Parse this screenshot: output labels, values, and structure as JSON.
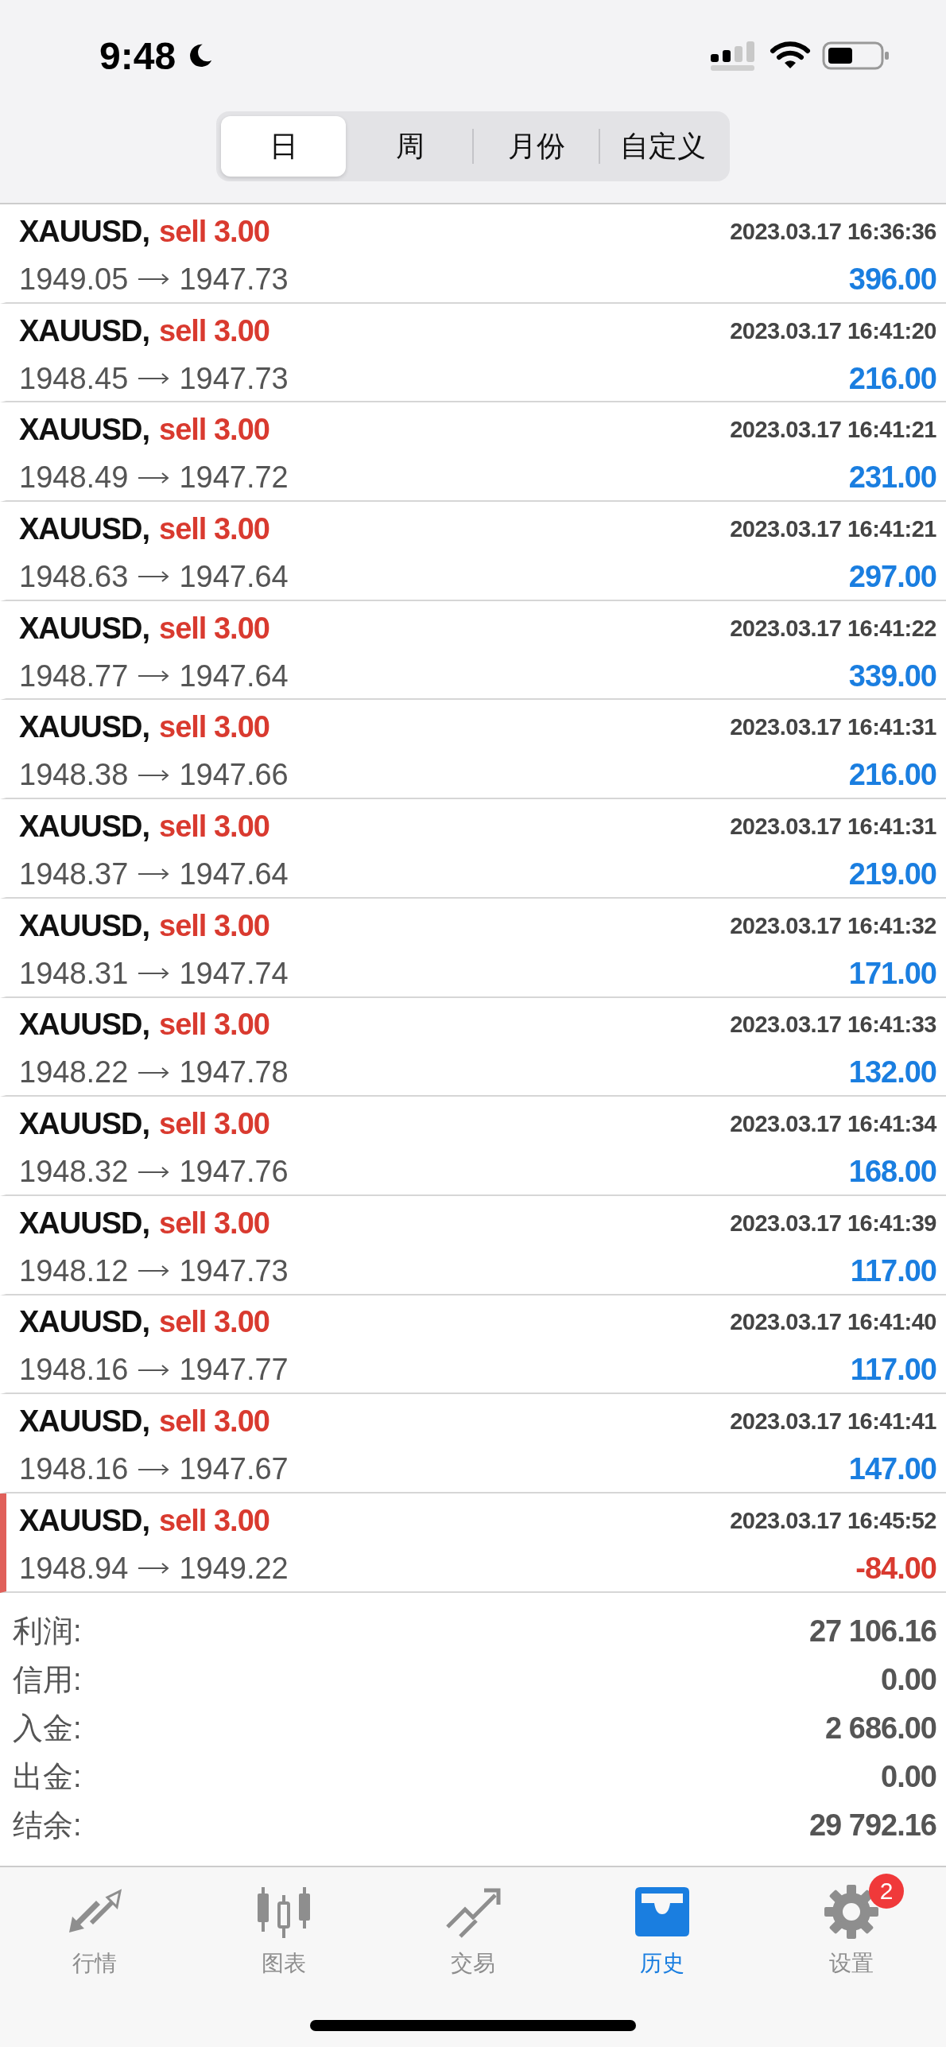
{
  "status_bar": {
    "time": "9:48"
  },
  "period_tabs": [
    {
      "label": "日",
      "selected": true
    },
    {
      "label": "周",
      "selected": false
    },
    {
      "label": "月份",
      "selected": false
    },
    {
      "label": "自定义",
      "selected": false
    }
  ],
  "deals": [
    {
      "symbol": "XAUUSD,",
      "side": "sell 3.00",
      "time": "2023.03.17 16:36:36",
      "open_price": "1949.05",
      "close_price": "1947.73",
      "profit": "396.00",
      "kind": "profit"
    },
    {
      "symbol": "XAUUSD,",
      "side": "sell 3.00",
      "time": "2023.03.17 16:41:20",
      "open_price": "1948.45",
      "close_price": "1947.73",
      "profit": "216.00",
      "kind": "profit"
    },
    {
      "symbol": "XAUUSD,",
      "side": "sell 3.00",
      "time": "2023.03.17 16:41:21",
      "open_price": "1948.49",
      "close_price": "1947.72",
      "profit": "231.00",
      "kind": "profit"
    },
    {
      "symbol": "XAUUSD,",
      "side": "sell 3.00",
      "time": "2023.03.17 16:41:21",
      "open_price": "1948.63",
      "close_price": "1947.64",
      "profit": "297.00",
      "kind": "profit"
    },
    {
      "symbol": "XAUUSD,",
      "side": "sell 3.00",
      "time": "2023.03.17 16:41:22",
      "open_price": "1948.77",
      "close_price": "1947.64",
      "profit": "339.00",
      "kind": "profit"
    },
    {
      "symbol": "XAUUSD,",
      "side": "sell 3.00",
      "time": "2023.03.17 16:41:31",
      "open_price": "1948.38",
      "close_price": "1947.66",
      "profit": "216.00",
      "kind": "profit"
    },
    {
      "symbol": "XAUUSD,",
      "side": "sell 3.00",
      "time": "2023.03.17 16:41:31",
      "open_price": "1948.37",
      "close_price": "1947.64",
      "profit": "219.00",
      "kind": "profit"
    },
    {
      "symbol": "XAUUSD,",
      "side": "sell 3.00",
      "time": "2023.03.17 16:41:32",
      "open_price": "1948.31",
      "close_price": "1947.74",
      "profit": "171.00",
      "kind": "profit"
    },
    {
      "symbol": "XAUUSD,",
      "side": "sell 3.00",
      "time": "2023.03.17 16:41:33",
      "open_price": "1948.22",
      "close_price": "1947.78",
      "profit": "132.00",
      "kind": "profit"
    },
    {
      "symbol": "XAUUSD,",
      "side": "sell 3.00",
      "time": "2023.03.17 16:41:34",
      "open_price": "1948.32",
      "close_price": "1947.76",
      "profit": "168.00",
      "kind": "profit"
    },
    {
      "symbol": "XAUUSD,",
      "side": "sell 3.00",
      "time": "2023.03.17 16:41:39",
      "open_price": "1948.12",
      "close_price": "1947.73",
      "profit": "117.00",
      "kind": "profit"
    },
    {
      "symbol": "XAUUSD,",
      "side": "sell 3.00",
      "time": "2023.03.17 16:41:40",
      "open_price": "1948.16",
      "close_price": "1947.77",
      "profit": "117.00",
      "kind": "profit"
    },
    {
      "symbol": "XAUUSD,",
      "side": "sell 3.00",
      "time": "2023.03.17 16:41:41",
      "open_price": "1948.16",
      "close_price": "1947.67",
      "profit": "147.00",
      "kind": "profit"
    },
    {
      "symbol": "XAUUSD,",
      "side": "sell 3.00",
      "time": "2023.03.17 16:45:52",
      "open_price": "1948.94",
      "close_price": "1949.22",
      "profit": "-84.00",
      "kind": "loss"
    }
  ],
  "summary": [
    {
      "label": "利润:",
      "value": "27 106.16"
    },
    {
      "label": "信用:",
      "value": "0.00"
    },
    {
      "label": "入金:",
      "value": "2 686.00"
    },
    {
      "label": "出金:",
      "value": "0.00"
    },
    {
      "label": "结余:",
      "value": "29 792.16"
    }
  ],
  "nav": [
    {
      "label": "行情",
      "selected": false
    },
    {
      "label": "图表",
      "selected": false
    },
    {
      "label": "交易",
      "selected": false
    },
    {
      "label": "历史",
      "selected": true
    },
    {
      "label": "设置",
      "selected": false,
      "badge": "2"
    }
  ]
}
